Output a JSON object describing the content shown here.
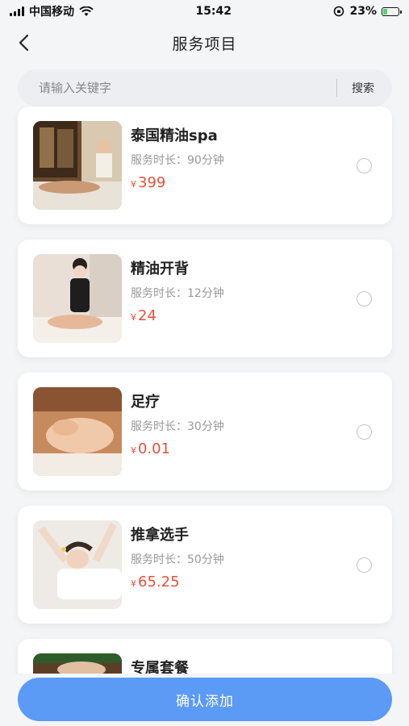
{
  "status_bar": {
    "carrier": "中国移动",
    "time": "15:42",
    "battery": "23%"
  },
  "nav": {
    "title": "服务项目"
  },
  "search": {
    "placeholder": "请输入关键字",
    "button_label": "搜索"
  },
  "services": [
    {
      "name": "泰国精油spa",
      "duration": "服务时长：90分钟",
      "currency": "¥",
      "price": "399"
    },
    {
      "name": "精油开背",
      "duration": "服务时长：12分钟",
      "currency": "¥",
      "price": "24"
    },
    {
      "name": "足疗",
      "duration": "服务时长：30分钟",
      "currency": "¥",
      "price": "0.01"
    },
    {
      "name": "推拿选手",
      "duration": "服务时长：50分钟",
      "currency": "¥",
      "price": "65.25"
    },
    {
      "name": "专属套餐"
    }
  ],
  "confirm_button": "确认添加",
  "colors": {
    "accent": "#5b9af5",
    "price": "#e8503a",
    "background": "#f4f5f7"
  }
}
